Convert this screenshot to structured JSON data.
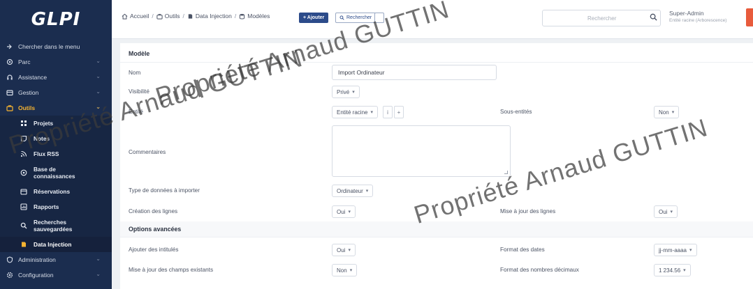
{
  "app": {
    "logo": "GLPI"
  },
  "sidebar": {
    "items": [
      {
        "label": "Chercher dans le menu",
        "icon": "search-menu-icon",
        "chevron": false
      },
      {
        "label": "Parc",
        "icon": "asset-icon",
        "chevron": true
      },
      {
        "label": "Assistance",
        "icon": "headset-icon",
        "chevron": true
      },
      {
        "label": "Gestion",
        "icon": "wallet-icon",
        "chevron": true
      },
      {
        "label": "Outils",
        "icon": "briefcase-icon",
        "chevron": true,
        "active": true
      }
    ],
    "submenu": [
      {
        "label": "Projets",
        "icon": "projects-icon"
      },
      {
        "label": "Notes",
        "icon": "notes-icon"
      },
      {
        "label": "Flux RSS",
        "icon": "rss-icon"
      },
      {
        "label": "Base de connaissances",
        "icon": "knowledge-icon"
      },
      {
        "label": "Réservations",
        "icon": "calendar-icon"
      },
      {
        "label": "Rapports",
        "icon": "reports-icon"
      },
      {
        "label": "Recherches sauvegardées",
        "icon": "saved-search-icon"
      },
      {
        "label": "Data Injection",
        "icon": "data-injection-icon",
        "current": true
      }
    ],
    "bottom_items": [
      {
        "label": "Administration",
        "icon": "admin-icon",
        "chevron": true
      },
      {
        "label": "Configuration",
        "icon": "gear-icon",
        "chevron": true
      }
    ]
  },
  "header": {
    "breadcrumb": [
      "Accueil",
      "Outils",
      "Data Injection",
      "Modèles"
    ],
    "add_label": "+ Ajouter",
    "search_label": "Rechercher",
    "search_placeholder": "Rechercher",
    "user_name": "Super-Admin",
    "user_entity": "Entité racine (Arborescence)"
  },
  "form": {
    "section_model": "Modèle",
    "name_label": "Nom",
    "name_value": "Import Ordinateur",
    "visibility_label": "Visibilité",
    "visibility_value": "Privé",
    "entity_label": "Entité",
    "entity_value": "Entité racine",
    "entity_btn_info": "i",
    "entity_btn_plus": "+",
    "subentities_label": "Sous-entités",
    "subentities_value": "Non",
    "comments_label": "Commentaires",
    "comments_value": "",
    "datatype_label": "Type de données à importer",
    "datatype_value": "Ordinateur",
    "create_lines_label": "Création des lignes",
    "create_lines_value": "Oui",
    "update_lines_label": "Mise à jour des lignes",
    "update_lines_value": "Oui",
    "section_advanced": "Options avancées",
    "add_titles_label": "Ajouter des intitulés",
    "add_titles_value": "Oui",
    "date_format_label": "Format des dates",
    "date_format_value": "jj-mm-aaaa",
    "update_fields_label": "Mise à jour des champs existants",
    "update_fields_value": "Non",
    "decimal_format_label": "Format des nombres décimaux",
    "decimal_format_value": "1 234.56"
  },
  "watermark": "Propriété Arnaud GUTTIN",
  "colors": {
    "sidebar_bg": "#1b2d4f",
    "active_menu": "#f5b331",
    "primary_button": "#2c4b8a",
    "user_button": "#e85b3c"
  }
}
